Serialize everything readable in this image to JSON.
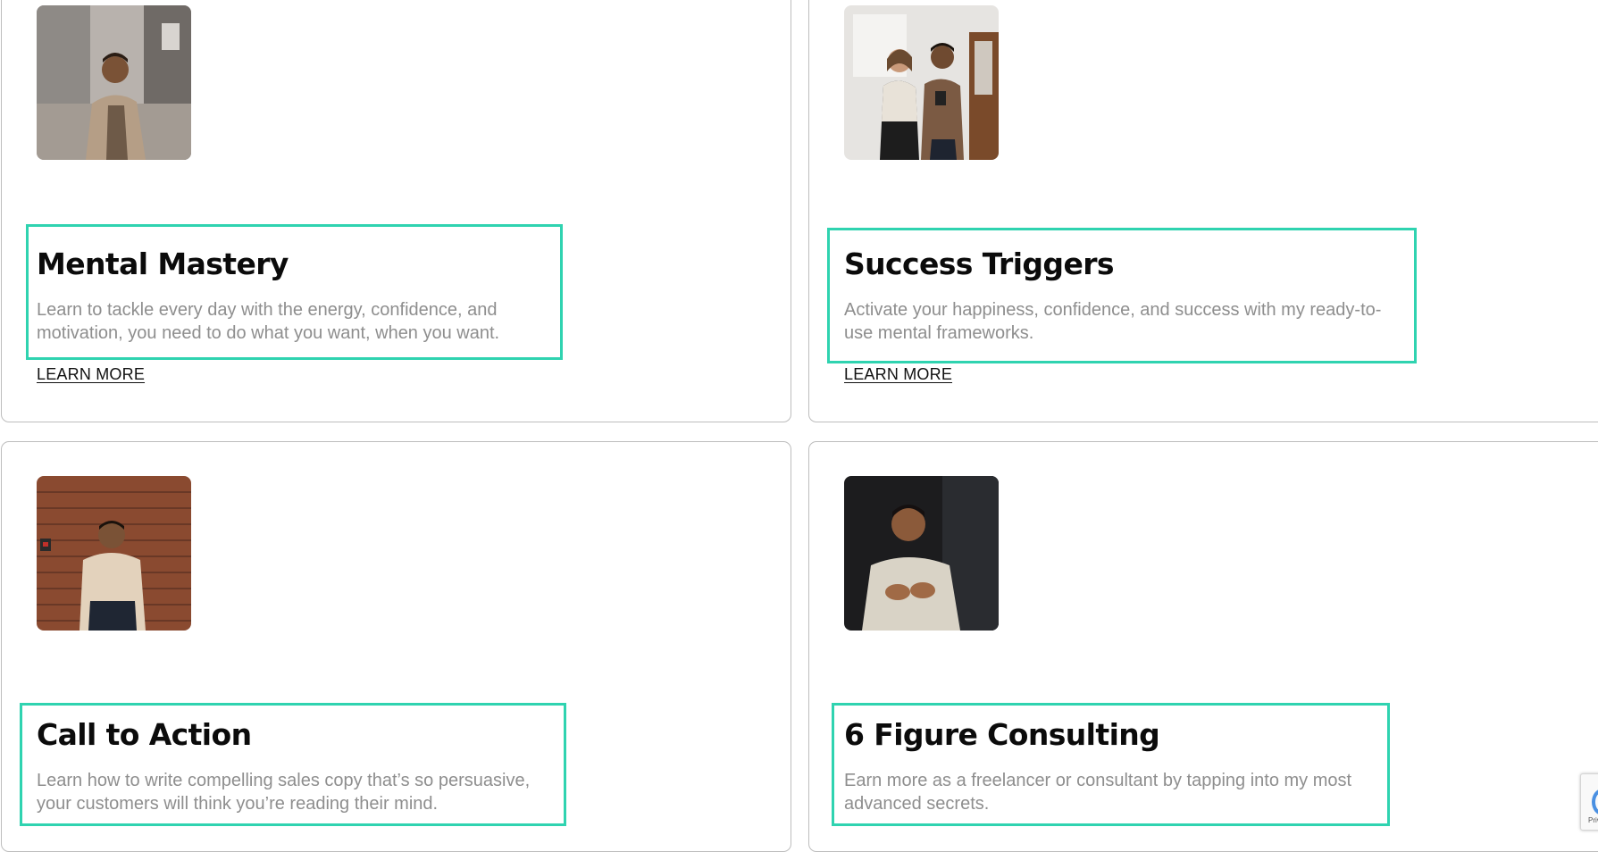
{
  "cards": [
    {
      "title": "Mental Mastery",
      "description": "Learn to tackle every day with the energy, confidence, and motivation, you need to do what you want, when you want.",
      "link_label": "LEARN MORE",
      "image": "portrait-man-in-coat-on-city-street"
    },
    {
      "title": "Success Triggers",
      "description": "Activate your happiness, confidence, and success with my ready-to-use mental frameworks.",
      "link_label": "LEARN MORE",
      "image": "man-and-woman-looking-at-phone"
    },
    {
      "title": "Call to Action",
      "description": "Learn how to write compelling sales copy that’s so persuasive, your customers will think you’re reading their mind.",
      "image": "man-standing-against-brick-wall"
    },
    {
      "title": "6 Figure Consulting",
      "description": "Earn more as a freelancer or consultant by tapping into my most advanced secrets.",
      "image": "man-gesturing-dark-background"
    }
  ],
  "recaptcha": {
    "label": "Priv"
  },
  "colors": {
    "highlight": "#2fd3b0",
    "card_border": "#bdbdbd",
    "title": "#0b0b0b",
    "description": "#8e8e8e"
  }
}
